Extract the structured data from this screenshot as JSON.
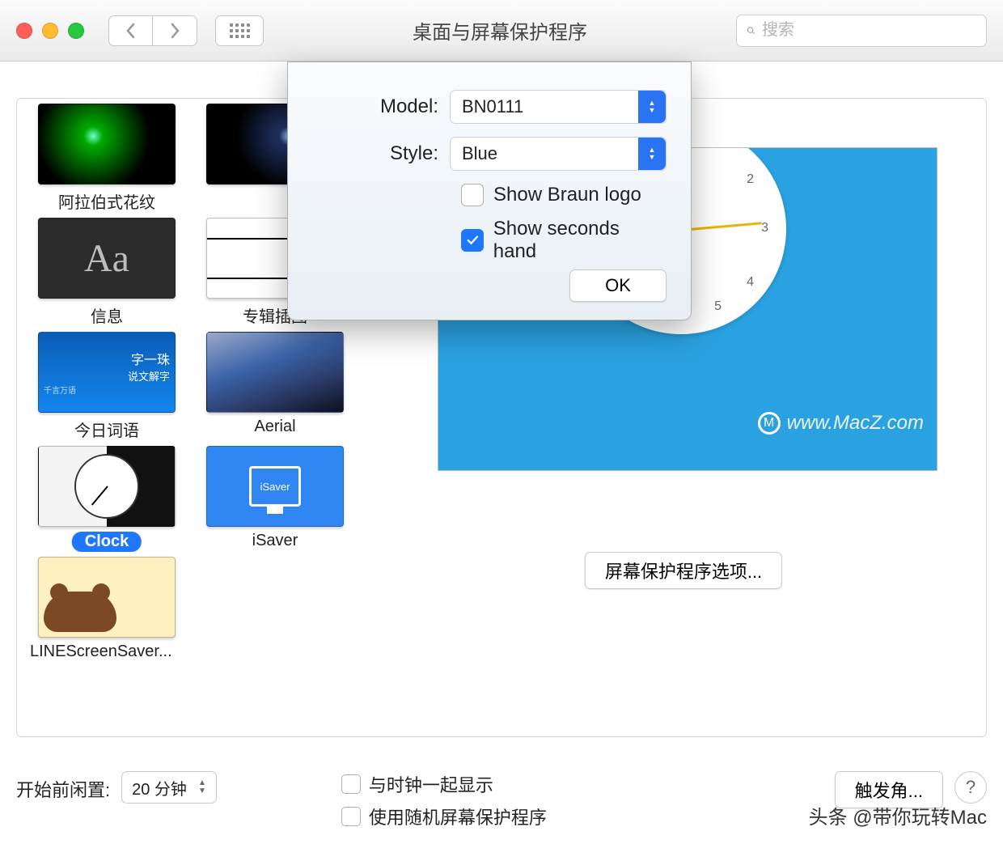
{
  "window": {
    "title": "桌面与屏幕保护程序"
  },
  "search": {
    "placeholder": "搜索"
  },
  "savers": [
    {
      "label": "阿拉伯式花纹",
      "kind": "ara"
    },
    {
      "label": "",
      "kind": "ara2"
    },
    {
      "label": "信息",
      "kind": "msg"
    },
    {
      "label": "专辑插图",
      "kind": "album"
    },
    {
      "label": "今日词语",
      "kind": "word"
    },
    {
      "label": "Aerial",
      "kind": "aerial"
    },
    {
      "label": "Clock",
      "kind": "clock",
      "selected": true
    },
    {
      "label": "iSaver",
      "kind": "isaver"
    },
    {
      "label": "LINEScreenSaver...",
      "kind": "line"
    }
  ],
  "word_thumb": {
    "line1": "字一珠",
    "line2": "说文解字",
    "line3": "千言万语"
  },
  "isaver_thumb": {
    "label": "iSaver"
  },
  "preview": {
    "watermark": "www.MacZ.com",
    "watermark_badge": "M"
  },
  "options_button": "屏幕保护程序选项...",
  "bottom": {
    "idle_label": "开始前闲置:",
    "idle_value": "20 分钟",
    "show_clock": "与时钟一起显示",
    "random": "使用随机屏幕保护程序",
    "hotcorner": "触发角...",
    "help": "?"
  },
  "sheet": {
    "model_label": "Model:",
    "model_value": "BN0111",
    "style_label": "Style:",
    "style_value": "Blue",
    "show_logo": "Show Braun logo",
    "show_seconds": "Show seconds hand",
    "ok": "OK"
  },
  "footer_watermark": "头条 @带你玩转Mac"
}
